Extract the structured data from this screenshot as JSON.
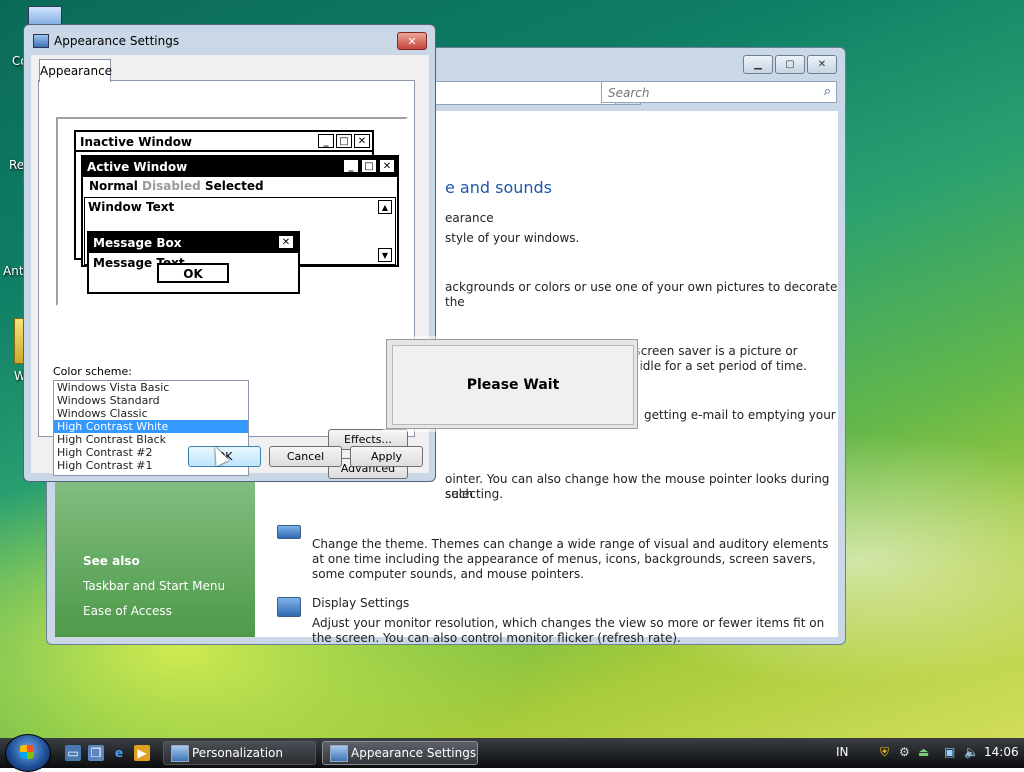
{
  "desktop": {
    "icon_labels": [
      "Co",
      "Re",
      "Ant",
      "W"
    ]
  },
  "personalization": {
    "search_placeholder": "Search",
    "section_title": "e and sounds",
    "appearance_link": "earance",
    "appearance_desc": "style of your windows.",
    "desktop_bg_desc": "ackgrounds or colors or use one of your own pictures to decorate the",
    "screensaver_desc_1": "er or adjust when it displays. A screen saver is a picture or animation that",
    "screensaver_desc_2": "appears when your computer is idle for a set period of time.",
    "sounds_desc": "getting e-mail to emptying your",
    "mouse_desc_1": "ointer. You can also change how the mouse pointer looks during such",
    "mouse_desc_2": "selecting.",
    "theme_desc": "Change the theme. Themes can change a wide range of visual and auditory elements at one time including the appearance of menus, icons, backgrounds, screen savers, some computer sounds, and mouse pointers.",
    "display_link": "Display Settings",
    "display_desc": "Adjust your monitor resolution, which changes the view so more or fewer items fit on the screen. You can also control monitor flicker (refresh rate).",
    "see_also": "See also",
    "see_also_items": [
      "Taskbar and Start Menu",
      "Ease of Access"
    ]
  },
  "appearance_dialog": {
    "title": "Appearance Settings",
    "tab": "Appearance",
    "preview": {
      "inactive_window": "Inactive Window",
      "active_window": "Active Window",
      "menu_normal": "Normal",
      "menu_disabled": "Disabled",
      "menu_selected": "Selected",
      "window_text": "Window Text",
      "message_box": "Message Box",
      "message_text": "Message Text",
      "ok": "OK"
    },
    "color_scheme_label": "Color scheme:",
    "color_schemes": [
      "Windows Vista Basic",
      "Windows Standard",
      "Windows Classic",
      "High Contrast White",
      "High Contrast Black",
      "High Contrast #2",
      "High Contrast #1"
    ],
    "selected_scheme": "High Contrast White",
    "effects_button": "Effects...",
    "advanced_button": "Advanced",
    "ok_button": "OK",
    "cancel_button": "Cancel",
    "apply_button": "Apply"
  },
  "please_wait": {
    "text": "Please Wait"
  },
  "taskbar": {
    "tasks": [
      "Personalization",
      "Appearance Settings"
    ],
    "language": "IN",
    "clock": "14:06"
  }
}
